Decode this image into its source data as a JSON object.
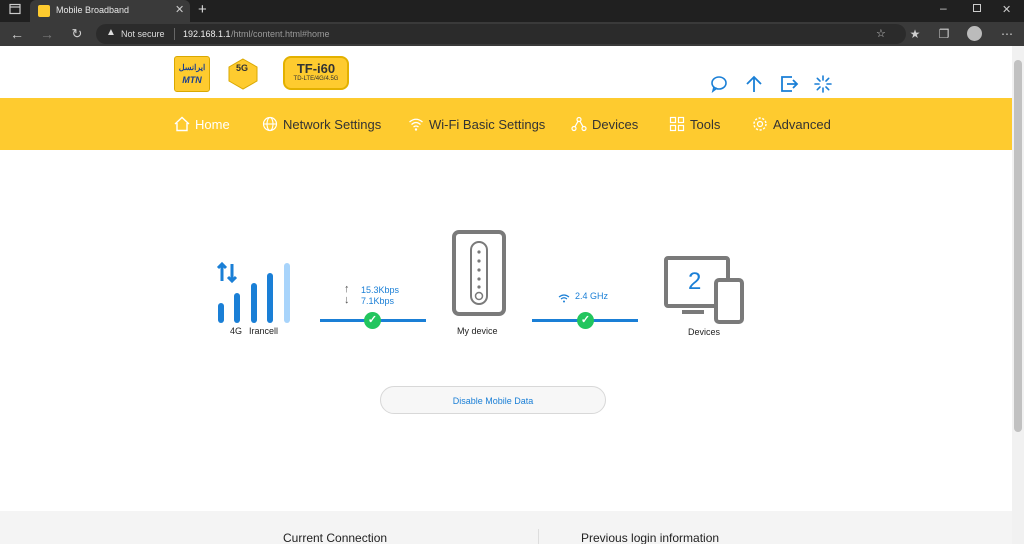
{
  "browser": {
    "tab_title": "Mobile Broadband",
    "security_label": "Not secure",
    "url_host": "192.168.1.1",
    "url_path": "/html/content.html#home",
    "new_tab_symbol": "+"
  },
  "header": {
    "brand_logo_text": "ایرانسل",
    "brand_logo_sub": "MTN",
    "badge_5g": "5G",
    "model_name": "TF-i60",
    "model_sub": "TD-LTE/4G/4.5G",
    "icons": [
      "message-icon",
      "upload-icon",
      "logout-icon",
      "loading-icon"
    ]
  },
  "nav": {
    "items": [
      {
        "label": "Home",
        "icon": "home-icon",
        "active": true
      },
      {
        "label": "Network Settings",
        "icon": "globe-icon",
        "active": false
      },
      {
        "label": "Wi-Fi Basic Settings",
        "icon": "wifi-icon",
        "active": false
      },
      {
        "label": "Devices",
        "icon": "network-icon",
        "active": false
      },
      {
        "label": "Tools",
        "icon": "tools-icon",
        "active": false
      },
      {
        "label": "Advanced",
        "icon": "gear-icon",
        "active": false
      }
    ]
  },
  "status": {
    "network_type": "4G",
    "operator": "Irancell",
    "upload_speed": "15.3Kbps",
    "download_speed": "7.1Kbps",
    "device_label": "My device",
    "wifi_band": "2.4 GHz",
    "devices_count": "2",
    "devices_label": "Devices",
    "colors": {
      "accent": "#1a7fd6",
      "ok": "#22c55e",
      "nav": "#fecb2f"
    }
  },
  "actions": {
    "disable_mobile_data": "Disable Mobile Data"
  },
  "sections": {
    "current_connection": "Current Connection",
    "previous_login": "Previous login information"
  }
}
